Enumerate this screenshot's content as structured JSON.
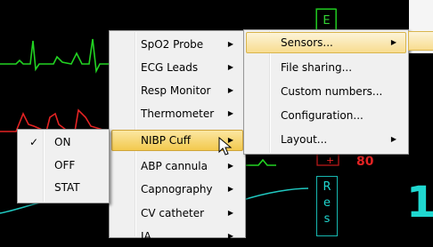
{
  "monitor": {
    "top_box_letter": "E",
    "resp_box_letters": [
      "R",
      "e",
      "s"
    ],
    "value_80": "80",
    "big_digit": "1"
  },
  "context_menu": {
    "items": [
      {
        "label": "SpO2 Probe",
        "has_submenu": true
      },
      {
        "label": "ECG Leads",
        "has_submenu": true
      },
      {
        "label": "Resp Monitor",
        "has_submenu": true
      },
      {
        "label": "Thermometer",
        "has_submenu": true
      },
      {
        "label": "NIBP Cuff",
        "has_submenu": true,
        "highlighted": true
      },
      {
        "label": "ABP cannula",
        "has_submenu": true
      },
      {
        "label": "Capnography",
        "has_submenu": true
      },
      {
        "label": "CV catheter",
        "has_submenu": true
      },
      {
        "label": "IA...",
        "has_submenu": true
      }
    ]
  },
  "settings_menu": {
    "items": [
      {
        "label": "Sensors...",
        "has_submenu": true,
        "highlighted": true
      },
      {
        "label": "File sharing...",
        "has_submenu": false
      },
      {
        "label": "Custom numbers...",
        "has_submenu": false
      },
      {
        "label": "Configuration...",
        "has_submenu": false
      },
      {
        "label": "Layout...",
        "has_submenu": true
      }
    ]
  },
  "nibp_submenu": {
    "items": [
      {
        "label": "ON",
        "checked": true
      },
      {
        "label": "OFF",
        "checked": false
      },
      {
        "label": "STAT",
        "checked": false
      }
    ]
  },
  "icons": {
    "submenu_arrow": "▶",
    "check": "✓"
  },
  "colors": {
    "ecg": "#22d322",
    "abp": "#e42323",
    "resp": "#20c8c0",
    "menu_bg": "#f0f0f0",
    "highlight": "#f8dc8f"
  }
}
